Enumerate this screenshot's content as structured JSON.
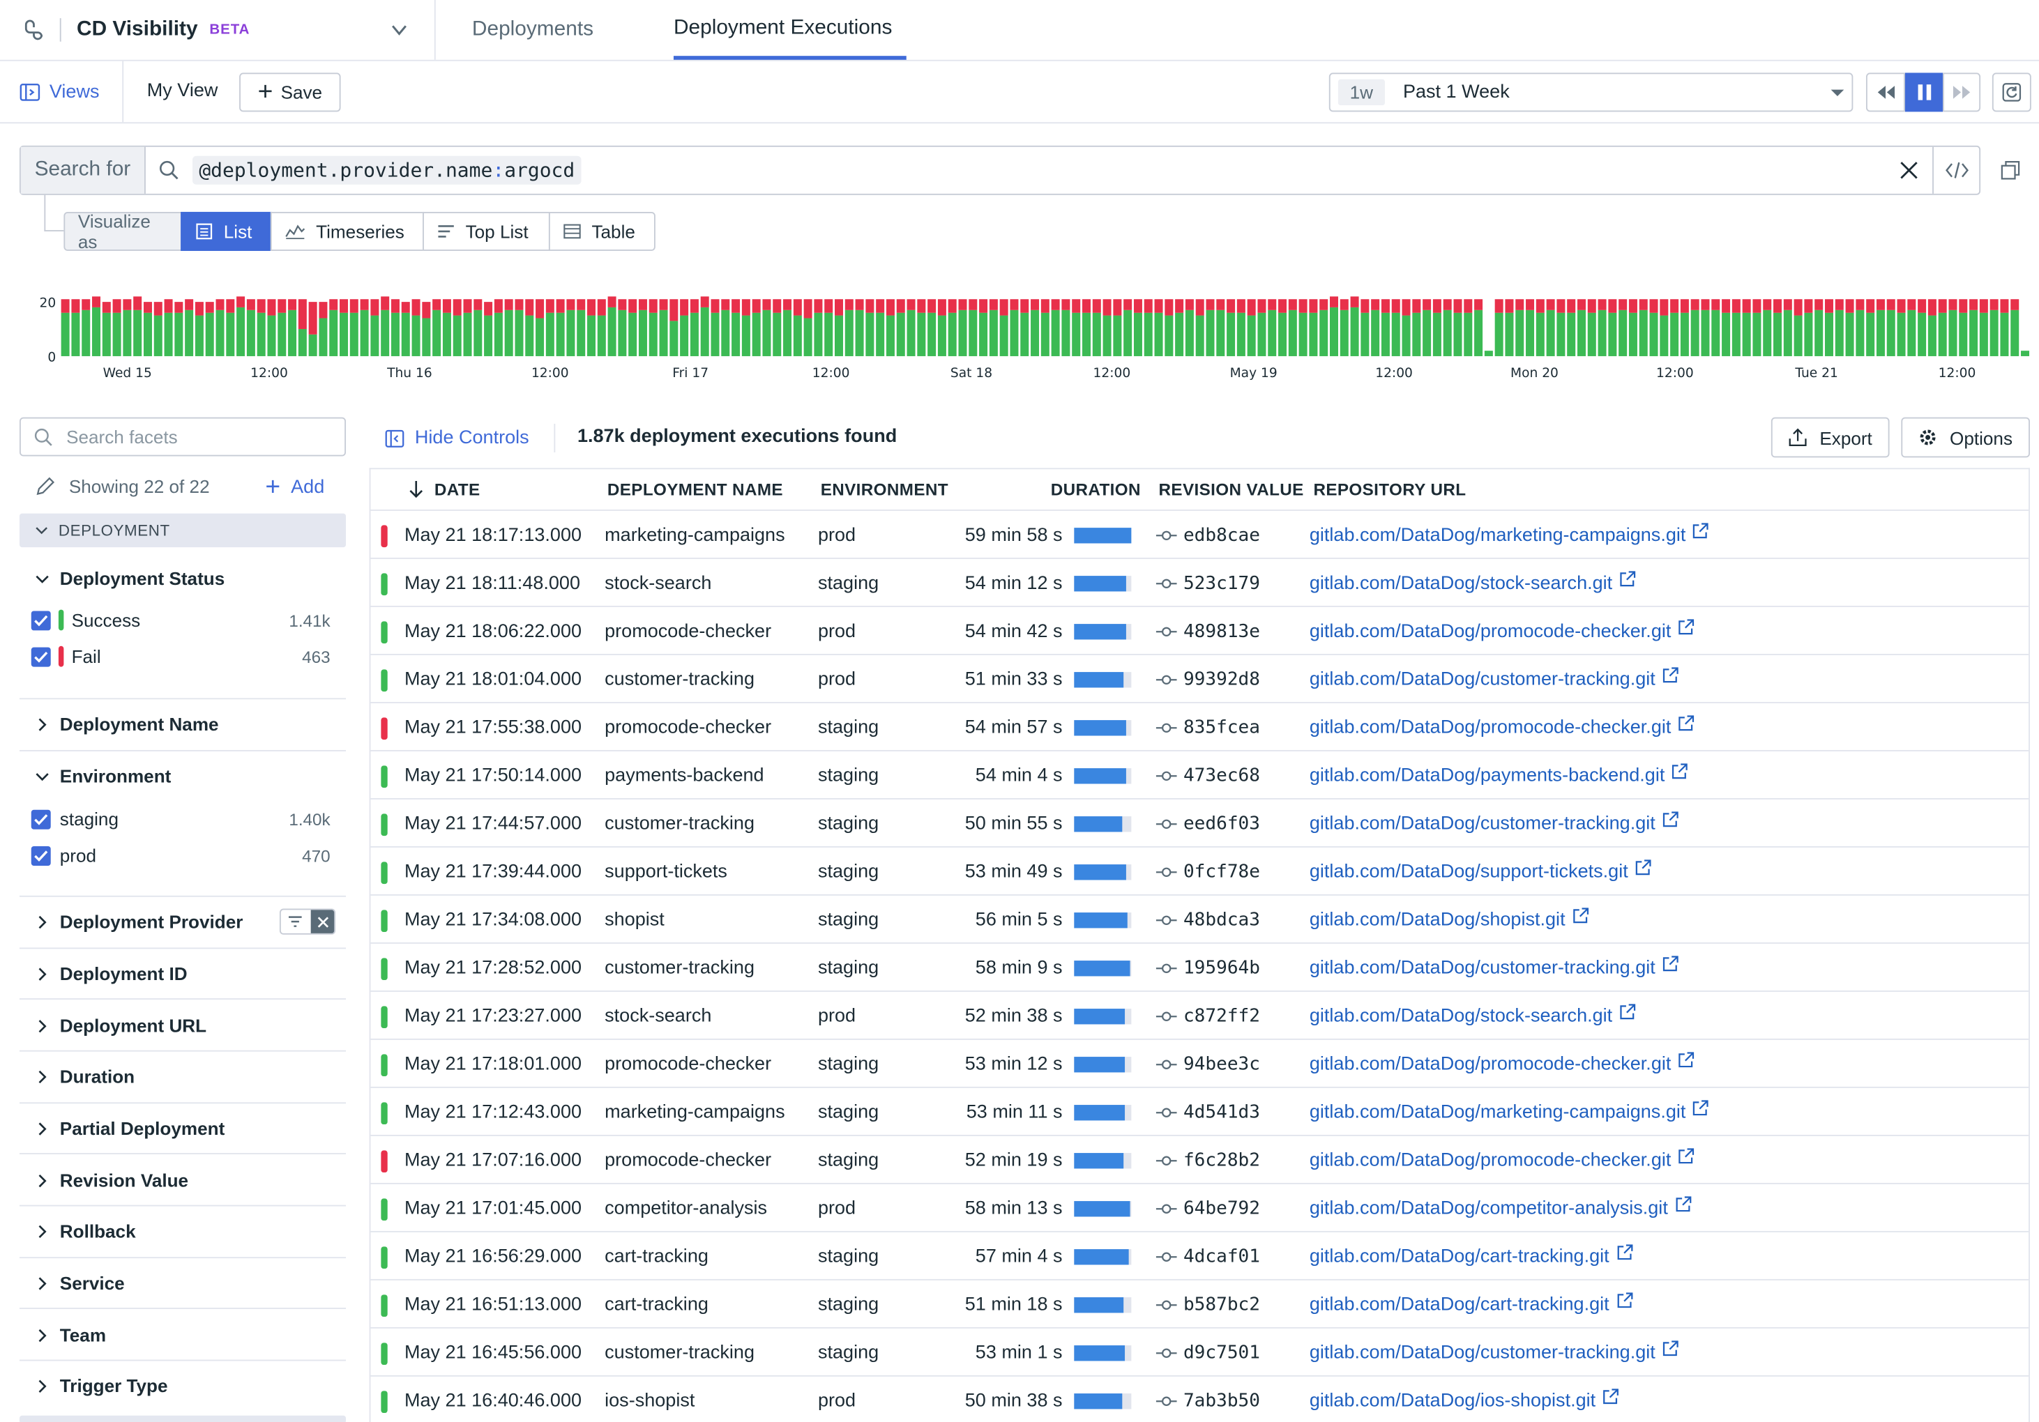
{
  "nav": {
    "product_title": "CD Visibility",
    "beta": "BETA",
    "tabs": [
      {
        "label": "Deployments",
        "active": false
      },
      {
        "label": "Deployment Executions",
        "active": true
      }
    ]
  },
  "views_bar": {
    "views_label": "Views",
    "my_view": "My View",
    "save_label": "Save",
    "time_badge": "1w",
    "time_label": "Past 1 Week"
  },
  "search": {
    "search_for": "Search for",
    "query_attr": "@deployment.provider.name",
    "query_sep": ":",
    "query_value": "argocd"
  },
  "visualize": {
    "label": "Visualize as",
    "options": [
      {
        "label": "List",
        "active": true
      },
      {
        "label": "Timeseries",
        "active": false
      },
      {
        "label": "Top List",
        "active": false
      },
      {
        "label": "Table",
        "active": false
      }
    ]
  },
  "chart_data": {
    "type": "bar",
    "stacked": true,
    "series": [
      {
        "name": "Success",
        "color": "#3cba54",
        "values": [
          16,
          16,
          17,
          18,
          16,
          16,
          17,
          17,
          16,
          15,
          16,
          16,
          17,
          15,
          16,
          17,
          16,
          18,
          17,
          16,
          15,
          16,
          17,
          10,
          8,
          14,
          17,
          16,
          16,
          17,
          15,
          17,
          16,
          16,
          15,
          14,
          17,
          16,
          15,
          16,
          17,
          15,
          16,
          17,
          17,
          15,
          14,
          16,
          16,
          17,
          17,
          15,
          15,
          18,
          17,
          16,
          17,
          16,
          17,
          13,
          15,
          16,
          18,
          16,
          17,
          16,
          15,
          16,
          17,
          16,
          17,
          15,
          14,
          16,
          16,
          15,
          17,
          17,
          16,
          16,
          15,
          16,
          17,
          16,
          16,
          15,
          16,
          17,
          17,
          16,
          17,
          15,
          17,
          16,
          17,
          16,
          17,
          17,
          16,
          16,
          16,
          15,
          15,
          17,
          16,
          16,
          16,
          15,
          16,
          17,
          15,
          17,
          17,
          16,
          16,
          15,
          16,
          17,
          16,
          17,
          16,
          16,
          17,
          18,
          17,
          18,
          16,
          17,
          16,
          16,
          15,
          16,
          17,
          16,
          17,
          16,
          16,
          17,
          2,
          16,
          16,
          17,
          17,
          16,
          17,
          16,
          16,
          17,
          16,
          17,
          16,
          17,
          16,
          17,
          16,
          15,
          16,
          16,
          17,
          17,
          17,
          16,
          16,
          16,
          16,
          17,
          16,
          17,
          15,
          16,
          17,
          16,
          17,
          16,
          17,
          16,
          17,
          17,
          16,
          17,
          16,
          15,
          16,
          17,
          16,
          17,
          16,
          17,
          16,
          17,
          2
        ]
      },
      {
        "name": "Fail",
        "color": "#e8304a",
        "values": [
          5,
          5,
          4,
          4,
          4,
          5,
          4,
          5,
          4,
          5,
          5,
          4,
          4,
          5,
          4,
          4,
          5,
          4,
          4,
          5,
          6,
          5,
          4,
          11,
          12,
          6,
          4,
          5,
          5,
          4,
          6,
          5,
          5,
          4,
          6,
          6,
          4,
          5,
          6,
          5,
          4,
          5,
          5,
          4,
          4,
          6,
          7,
          5,
          5,
          4,
          4,
          6,
          6,
          4,
          4,
          5,
          4,
          5,
          4,
          8,
          6,
          5,
          4,
          5,
          4,
          5,
          6,
          5,
          4,
          5,
          4,
          6,
          7,
          5,
          5,
          6,
          4,
          4,
          5,
          5,
          6,
          5,
          4,
          5,
          5,
          6,
          5,
          4,
          4,
          5,
          4,
          6,
          4,
          5,
          4,
          5,
          4,
          4,
          5,
          5,
          5,
          6,
          6,
          4,
          5,
          5,
          5,
          6,
          5,
          4,
          6,
          4,
          4,
          5,
          5,
          6,
          5,
          4,
          5,
          4,
          5,
          5,
          4,
          4,
          4,
          4,
          5,
          4,
          5,
          5,
          6,
          5,
          4,
          5,
          4,
          5,
          5,
          4,
          0,
          5,
          5,
          4,
          4,
          5,
          4,
          5,
          5,
          4,
          5,
          4,
          5,
          4,
          5,
          4,
          5,
          6,
          5,
          5,
          4,
          4,
          4,
          5,
          5,
          5,
          5,
          4,
          5,
          4,
          6,
          5,
          4,
          5,
          4,
          5,
          4,
          5,
          4,
          4,
          5,
          4,
          5,
          6,
          5,
          4,
          5,
          4,
          5,
          4,
          5,
          4,
          0
        ]
      }
    ],
    "y_ticks": [
      "20",
      "0"
    ],
    "ylim": [
      0,
      23
    ],
    "x_ticks": [
      "Wed 15",
      "12:00",
      "Thu 16",
      "12:00",
      "Fri 17",
      "12:00",
      "Sat 18",
      "12:00",
      "May 19",
      "12:00",
      "Mon 20",
      "12:00",
      "Tue 21",
      "12:00"
    ]
  },
  "facets": {
    "search_placeholder": "Search facets",
    "showing": "Showing 22 of 22",
    "add": "Add",
    "group": "DEPLOYMENT",
    "status_title": "Deployment Status",
    "status_items": [
      {
        "label": "Success",
        "count": "1.41k",
        "color": "#3cba54"
      },
      {
        "label": "Fail",
        "count": "463",
        "color": "#e8304a"
      }
    ],
    "deployment_name": "Deployment Name",
    "environment_title": "Environment",
    "environment_items": [
      {
        "label": "staging",
        "count": "1.40k"
      },
      {
        "label": "prod",
        "count": "470"
      }
    ],
    "collapsed": [
      "Deployment Provider",
      "Deployment ID",
      "Deployment URL",
      "Duration",
      "Partial Deployment",
      "Revision Value",
      "Rollback",
      "Service",
      "Team",
      "Trigger Type"
    ]
  },
  "list_header": {
    "hide_controls": "Hide Controls",
    "count_text": "1.87k deployment executions found",
    "export": "Export",
    "options": "Options"
  },
  "table": {
    "columns": [
      "DATE",
      "DEPLOYMENT NAME",
      "ENVIRONMENT",
      "DURATION",
      "REVISION VALUE",
      "REPOSITORY URL"
    ],
    "rows": [
      {
        "status": "fail",
        "date": "May 21 18:17:13.000",
        "name": "marketing-campaigns",
        "env": "prod",
        "duration": "59 min 58 s",
        "pct": 100,
        "rev": "edb8cae",
        "repo": "gitlab.com/DataDog/marketing-campaigns.git"
      },
      {
        "status": "success",
        "date": "May 21 18:11:48.000",
        "name": "stock-search",
        "env": "staging",
        "duration": "54 min 12 s",
        "pct": 90,
        "rev": "523c179",
        "repo": "gitlab.com/DataDog/stock-search.git"
      },
      {
        "status": "success",
        "date": "May 21 18:06:22.000",
        "name": "promocode-checker",
        "env": "prod",
        "duration": "54 min 42 s",
        "pct": 91,
        "rev": "489813e",
        "repo": "gitlab.com/DataDog/promocode-checker.git"
      },
      {
        "status": "success",
        "date": "May 21 18:01:04.000",
        "name": "customer-tracking",
        "env": "prod",
        "duration": "51 min 33 s",
        "pct": 86,
        "rev": "99392d8",
        "repo": "gitlab.com/DataDog/customer-tracking.git"
      },
      {
        "status": "fail",
        "date": "May 21 17:55:38.000",
        "name": "promocode-checker",
        "env": "staging",
        "duration": "54 min 57 s",
        "pct": 92,
        "rev": "835fcea",
        "repo": "gitlab.com/DataDog/promocode-checker.git"
      },
      {
        "status": "success",
        "date": "May 21 17:50:14.000",
        "name": "payments-backend",
        "env": "staging",
        "duration": "54 min 4 s",
        "pct": 90,
        "rev": "473ec68",
        "repo": "gitlab.com/DataDog/payments-backend.git"
      },
      {
        "status": "success",
        "date": "May 21 17:44:57.000",
        "name": "customer-tracking",
        "env": "staging",
        "duration": "50 min 55 s",
        "pct": 85,
        "rev": "eed6f03",
        "repo": "gitlab.com/DataDog/customer-tracking.git"
      },
      {
        "status": "success",
        "date": "May 21 17:39:44.000",
        "name": "support-tickets",
        "env": "staging",
        "duration": "53 min 49 s",
        "pct": 90,
        "rev": "0fcf78e",
        "repo": "gitlab.com/DataDog/support-tickets.git"
      },
      {
        "status": "success",
        "date": "May 21 17:34:08.000",
        "name": "shopist",
        "env": "staging",
        "duration": "56 min 5 s",
        "pct": 94,
        "rev": "48bdca3",
        "repo": "gitlab.com/DataDog/shopist.git"
      },
      {
        "status": "success",
        "date": "May 21 17:28:52.000",
        "name": "customer-tracking",
        "env": "staging",
        "duration": "58 min 9 s",
        "pct": 97,
        "rev": "195964b",
        "repo": "gitlab.com/DataDog/customer-tracking.git"
      },
      {
        "status": "success",
        "date": "May 21 17:23:27.000",
        "name": "stock-search",
        "env": "prod",
        "duration": "52 min 38 s",
        "pct": 88,
        "rev": "c872ff2",
        "repo": "gitlab.com/DataDog/stock-search.git"
      },
      {
        "status": "success",
        "date": "May 21 17:18:01.000",
        "name": "promocode-checker",
        "env": "staging",
        "duration": "53 min 12 s",
        "pct": 89,
        "rev": "94bee3c",
        "repo": "gitlab.com/DataDog/promocode-checker.git"
      },
      {
        "status": "success",
        "date": "May 21 17:12:43.000",
        "name": "marketing-campaigns",
        "env": "staging",
        "duration": "53 min 11 s",
        "pct": 89,
        "rev": "4d541d3",
        "repo": "gitlab.com/DataDog/marketing-campaigns.git"
      },
      {
        "status": "fail",
        "date": "May 21 17:07:16.000",
        "name": "promocode-checker",
        "env": "staging",
        "duration": "52 min 19 s",
        "pct": 87,
        "rev": "f6c28b2",
        "repo": "gitlab.com/DataDog/promocode-checker.git"
      },
      {
        "status": "success",
        "date": "May 21 17:01:45.000",
        "name": "competitor-analysis",
        "env": "prod",
        "duration": "58 min 13 s",
        "pct": 97,
        "rev": "64be792",
        "repo": "gitlab.com/DataDog/competitor-analysis.git"
      },
      {
        "status": "success",
        "date": "May 21 16:56:29.000",
        "name": "cart-tracking",
        "env": "staging",
        "duration": "57 min 4 s",
        "pct": 95,
        "rev": "4dcaf01",
        "repo": "gitlab.com/DataDog/cart-tracking.git"
      },
      {
        "status": "success",
        "date": "May 21 16:51:13.000",
        "name": "cart-tracking",
        "env": "staging",
        "duration": "51 min 18 s",
        "pct": 86,
        "rev": "b587bc2",
        "repo": "gitlab.com/DataDog/cart-tracking.git"
      },
      {
        "status": "success",
        "date": "May 21 16:45:56.000",
        "name": "customer-tracking",
        "env": "staging",
        "duration": "53 min 1 s",
        "pct": 88,
        "rev": "d9c7501",
        "repo": "gitlab.com/DataDog/customer-tracking.git"
      },
      {
        "status": "success",
        "date": "May 21 16:40:46.000",
        "name": "ios-shopist",
        "env": "prod",
        "duration": "50 min 38 s",
        "pct": 84,
        "rev": "7ab3b50",
        "repo": "gitlab.com/DataDog/ios-shopist.git"
      }
    ]
  },
  "colors": {
    "accent": "#3f6ad8",
    "success": "#3cba54",
    "fail": "#e8304a",
    "duration_bar": "#3a86e0",
    "link": "#1f5fbf"
  }
}
